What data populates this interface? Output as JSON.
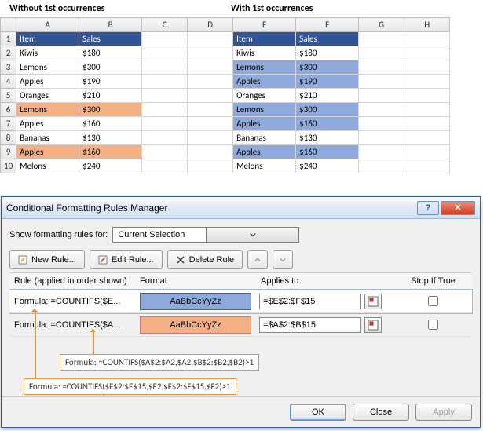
{
  "titles": {
    "left": "Without 1st occurrences",
    "right": "With 1st occurrences"
  },
  "columns": [
    "A",
    "B",
    "C",
    "D",
    "E",
    "F",
    "G",
    "H"
  ],
  "row_numbers": [
    1,
    2,
    3,
    4,
    5,
    6,
    7,
    8,
    9,
    10
  ],
  "header_row": {
    "item": "Item",
    "sales": "Sales"
  },
  "left_data": [
    {
      "item": "Kiwis",
      "sales": "$180",
      "hl": ""
    },
    {
      "item": "Lemons",
      "sales": "$300",
      "hl": ""
    },
    {
      "item": "Apples",
      "sales": "$190",
      "hl": ""
    },
    {
      "item": "Oranges",
      "sales": "$210",
      "hl": ""
    },
    {
      "item": "Lemons",
      "sales": "$300",
      "hl": "orange"
    },
    {
      "item": "Apples",
      "sales": "$160",
      "hl": ""
    },
    {
      "item": "Bananas",
      "sales": "$130",
      "hl": ""
    },
    {
      "item": "Apples",
      "sales": "$160",
      "hl": "orange"
    },
    {
      "item": "Melons",
      "sales": "$240",
      "hl": ""
    }
  ],
  "right_data": [
    {
      "item": "Kiwis",
      "sales": "$180",
      "hl": ""
    },
    {
      "item": "Lemons",
      "sales": "$300",
      "hl": "blue"
    },
    {
      "item": "Apples",
      "sales": "$190",
      "hl": "blue"
    },
    {
      "item": "Oranges",
      "sales": "$210",
      "hl": ""
    },
    {
      "item": "Lemons",
      "sales": "$300",
      "hl": "blue"
    },
    {
      "item": "Apples",
      "sales": "$160",
      "hl": "blue"
    },
    {
      "item": "Bananas",
      "sales": "$130",
      "hl": ""
    },
    {
      "item": "Apples",
      "sales": "$160",
      "hl": "blue"
    },
    {
      "item": "Melons",
      "sales": "$240",
      "hl": ""
    }
  ],
  "dialog": {
    "title": "Conditional Formatting Rules Manager",
    "show_label": "Show formatting rules for:",
    "show_value": "Current Selection",
    "btn_new": "New Rule...",
    "btn_edit": "Edit Rule...",
    "btn_delete": "Delete Rule",
    "head_rule": "Rule (applied in order shown)",
    "head_format": "Format",
    "head_applies": "Applies to",
    "head_stop": "Stop If True",
    "sample_text": "AaBbCcYyZz",
    "rules": [
      {
        "label": "Formula: =COUNTIFS($E...",
        "style": "blue",
        "applies": "=$E$2:$F$15"
      },
      {
        "label": "Formula: =COUNTIFS($A...",
        "style": "orange",
        "applies": "=$A$2:$B$15"
      }
    ],
    "ok": "OK",
    "close": "Close",
    "apply": "Apply"
  },
  "callouts": {
    "c1": "Formula: =COUNTIFS($A$2:$A2,$A2,$B$2:$B2,$B2)>1",
    "c2": "Formula: =COUNTIFS($E$2:$E$15,$E2,$F$2:$F$15,$F2)>1"
  }
}
